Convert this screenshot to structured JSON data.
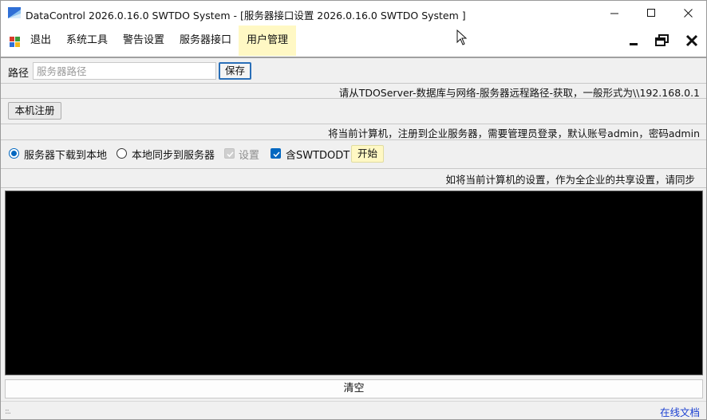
{
  "window": {
    "title": "DataControl 2026.0.16.0 SWTDO System  - [服务器接口设置 2026.0.16.0 SWTDO System ]"
  },
  "menu": {
    "items": [
      {
        "label": "退出"
      },
      {
        "label": "系统工具"
      },
      {
        "label": "警告设置"
      },
      {
        "label": "服务器接口"
      },
      {
        "label": "用户管理"
      }
    ]
  },
  "path_row": {
    "label": "路径",
    "placeholder": "服务器路径",
    "save_label": "保存"
  },
  "hints": {
    "path_hint": "请从TDOServer-数据库与网络-服务器远程路径-获取，一般形式为\\\\192.168.0.1",
    "register_hint": "将当前计算机，注册到企业服务器，需要管理员登录，默认账号admin，密码admin",
    "sync_hint": "如将当前计算机的设置，作为全企业的共享设置，请同步"
  },
  "register": {
    "label": "本机注册"
  },
  "sync_row": {
    "radio_download": "服务器下载到本地",
    "radio_upload": "本地同步到服务器",
    "check_settings": "设置",
    "check_swtdodt": "含SWTDODT",
    "start_label": "开始"
  },
  "bottom": {
    "clear_label": "清空",
    "grip": "::.",
    "online_doc": "在线文档"
  },
  "colors": {
    "accent": "#0067c0",
    "highlight": "#fff8c4",
    "console_bg": "#000000",
    "link": "#1a3fd1"
  }
}
